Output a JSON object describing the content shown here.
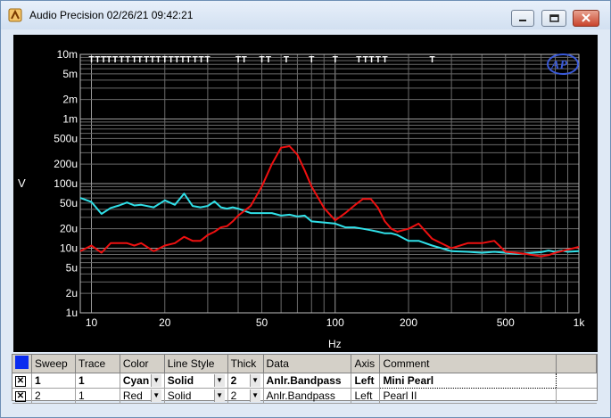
{
  "window": {
    "title": "Audio Precision  02/26/21 09:42:21",
    "colors": {
      "titlebar": "#d2e0f1",
      "close": "#c9442c"
    }
  },
  "chart_data": {
    "type": "line",
    "xscale": "log",
    "yscale": "log",
    "xlim": [
      9,
      1000
    ],
    "ylim": [
      1e-06,
      0.01
    ],
    "xlabel": "Hz",
    "ylabel": "V",
    "grid": true,
    "logo": "AP",
    "x_tick_labels": [
      {
        "v": 10,
        "t": "10"
      },
      {
        "v": 20,
        "t": "20"
      },
      {
        "v": 50,
        "t": "50"
      },
      {
        "v": 100,
        "t": "100"
      },
      {
        "v": 200,
        "t": "200"
      },
      {
        "v": 500,
        "t": "500"
      },
      {
        "v": 1000,
        "t": "1k"
      }
    ],
    "y_tick_labels": [
      {
        "v": 0.01,
        "t": "10m"
      },
      {
        "v": 0.005,
        "t": "5m"
      },
      {
        "v": 0.002,
        "t": "2m"
      },
      {
        "v": 0.001,
        "t": "1m"
      },
      {
        "v": 0.0005,
        "t": "500u"
      },
      {
        "v": 0.0002,
        "t": "200u"
      },
      {
        "v": 0.0001,
        "t": "100u"
      },
      {
        "v": 5e-05,
        "t": "50u"
      },
      {
        "v": 2e-05,
        "t": "20u"
      },
      {
        "v": 1e-05,
        "t": "10u"
      },
      {
        "v": 5e-06,
        "t": "5u"
      },
      {
        "v": 2e-06,
        "t": "2u"
      },
      {
        "v": 1e-06,
        "t": "1u"
      }
    ],
    "markers": {
      "glyph": "T",
      "x": [
        10,
        10.6,
        11.2,
        11.8,
        12.5,
        13.3,
        14.1,
        15,
        15.8,
        16.8,
        17.8,
        18.8,
        20,
        21.2,
        22.4,
        23.7,
        25,
        26.6,
        28.2,
        29.9,
        40,
        42.3,
        50,
        53.2,
        63,
        80,
        100,
        125,
        133,
        141,
        150,
        160,
        250
      ]
    },
    "series": [
      {
        "color": "#30e0e8",
        "x": [
          9,
          10,
          11,
          12,
          13,
          14,
          15,
          16,
          18,
          20,
          22,
          24,
          26,
          28,
          30,
          32,
          34,
          36,
          38,
          40,
          45,
          50,
          55,
          60,
          65,
          70,
          75,
          80,
          90,
          100,
          110,
          120,
          130,
          140,
          150,
          160,
          170,
          180,
          200,
          220,
          250,
          300,
          350,
          400,
          450,
          500,
          550,
          600,
          650,
          700,
          750,
          800,
          850,
          900,
          1000
        ],
        "values": [
          6e-05,
          5.2e-05,
          3.4e-05,
          4.2e-05,
          4.6e-05,
          5.1e-05,
          4.6e-05,
          4.7e-05,
          4.3e-05,
          5.5e-05,
          4.7e-05,
          7e-05,
          4.5e-05,
          4.3e-05,
          4.5e-05,
          5.3e-05,
          4.3e-05,
          4.1e-05,
          4.3e-05,
          4.1e-05,
          3.5e-05,
          3.5e-05,
          3.5e-05,
          3.2e-05,
          3.3e-05,
          3.1e-05,
          3.2e-05,
          2.6e-05,
          2.5e-05,
          2.4e-05,
          2.1e-05,
          2.1e-05,
          2e-05,
          1.9e-05,
          1.8e-05,
          1.7e-05,
          1.7e-05,
          1.6e-05,
          1.3e-05,
          1.3e-05,
          1.1e-05,
          9e-06,
          8.8e-06,
          8.5e-06,
          8.8e-06,
          8.5e-06,
          8.2e-06,
          8.3e-06,
          8.5e-06,
          8.7e-06,
          9.2e-06,
          8.8e-06,
          9.2e-06,
          8.8e-06,
          9e-06
        ]
      },
      {
        "color": "#ee1010",
        "x": [
          9,
          10,
          11,
          12,
          13,
          14,
          15,
          16,
          18,
          20,
          22,
          24,
          26,
          28,
          30,
          32,
          34,
          36,
          38,
          40,
          45,
          50,
          55,
          60,
          65,
          70,
          75,
          80,
          90,
          100,
          110,
          120,
          130,
          140,
          150,
          160,
          170,
          180,
          200,
          220,
          250,
          300,
          350,
          400,
          450,
          500,
          550,
          600,
          650,
          700,
          750,
          800,
          850,
          900,
          1000
        ],
        "values": [
          9e-06,
          1.1e-05,
          8.5e-06,
          1.2e-05,
          1.2e-05,
          1.2e-05,
          1.1e-05,
          1.2e-05,
          9e-06,
          1.1e-05,
          1.2e-05,
          1.5e-05,
          1.3e-05,
          1.3e-05,
          1.6e-05,
          1.8e-05,
          2.1e-05,
          2.2e-05,
          2.6e-05,
          3.2e-05,
          4.5e-05,
          9e-05,
          0.0002,
          0.00036,
          0.00038,
          0.00028,
          0.00016,
          9e-05,
          4.2e-05,
          2.7e-05,
          3.5e-05,
          4.6e-05,
          5.8e-05,
          5.8e-05,
          4.2e-05,
          2.6e-05,
          2e-05,
          1.8e-05,
          2e-05,
          2.4e-05,
          1.4e-05,
          1e-05,
          1.2e-05,
          1.2e-05,
          1.3e-05,
          8.8e-06,
          8.5e-06,
          8.2e-06,
          7.8e-06,
          7.5e-06,
          7.8e-06,
          8.5e-06,
          9e-06,
          9.5e-06,
          1.05e-05
        ]
      }
    ]
  },
  "trace_table": {
    "headers": [
      "Sweep",
      "Trace",
      "Color",
      "Line Style",
      "Thick",
      "Data",
      "Axis",
      "Comment"
    ],
    "rows": [
      {
        "sweep": "1",
        "trace": "1",
        "color": "Cyan",
        "style": "Solid",
        "thick": "2",
        "data": "Anlr.Bandpass",
        "axis": "Left",
        "comment": "Mini Pearl"
      },
      {
        "sweep": "2",
        "trace": "1",
        "color": "Red",
        "style": "Solid",
        "thick": "2",
        "data": "Anlr.Bandpass",
        "axis": "Left",
        "comment": "Pearl II"
      }
    ],
    "checkbox_glyph": "✕",
    "dropdown_glyph": "▼"
  }
}
